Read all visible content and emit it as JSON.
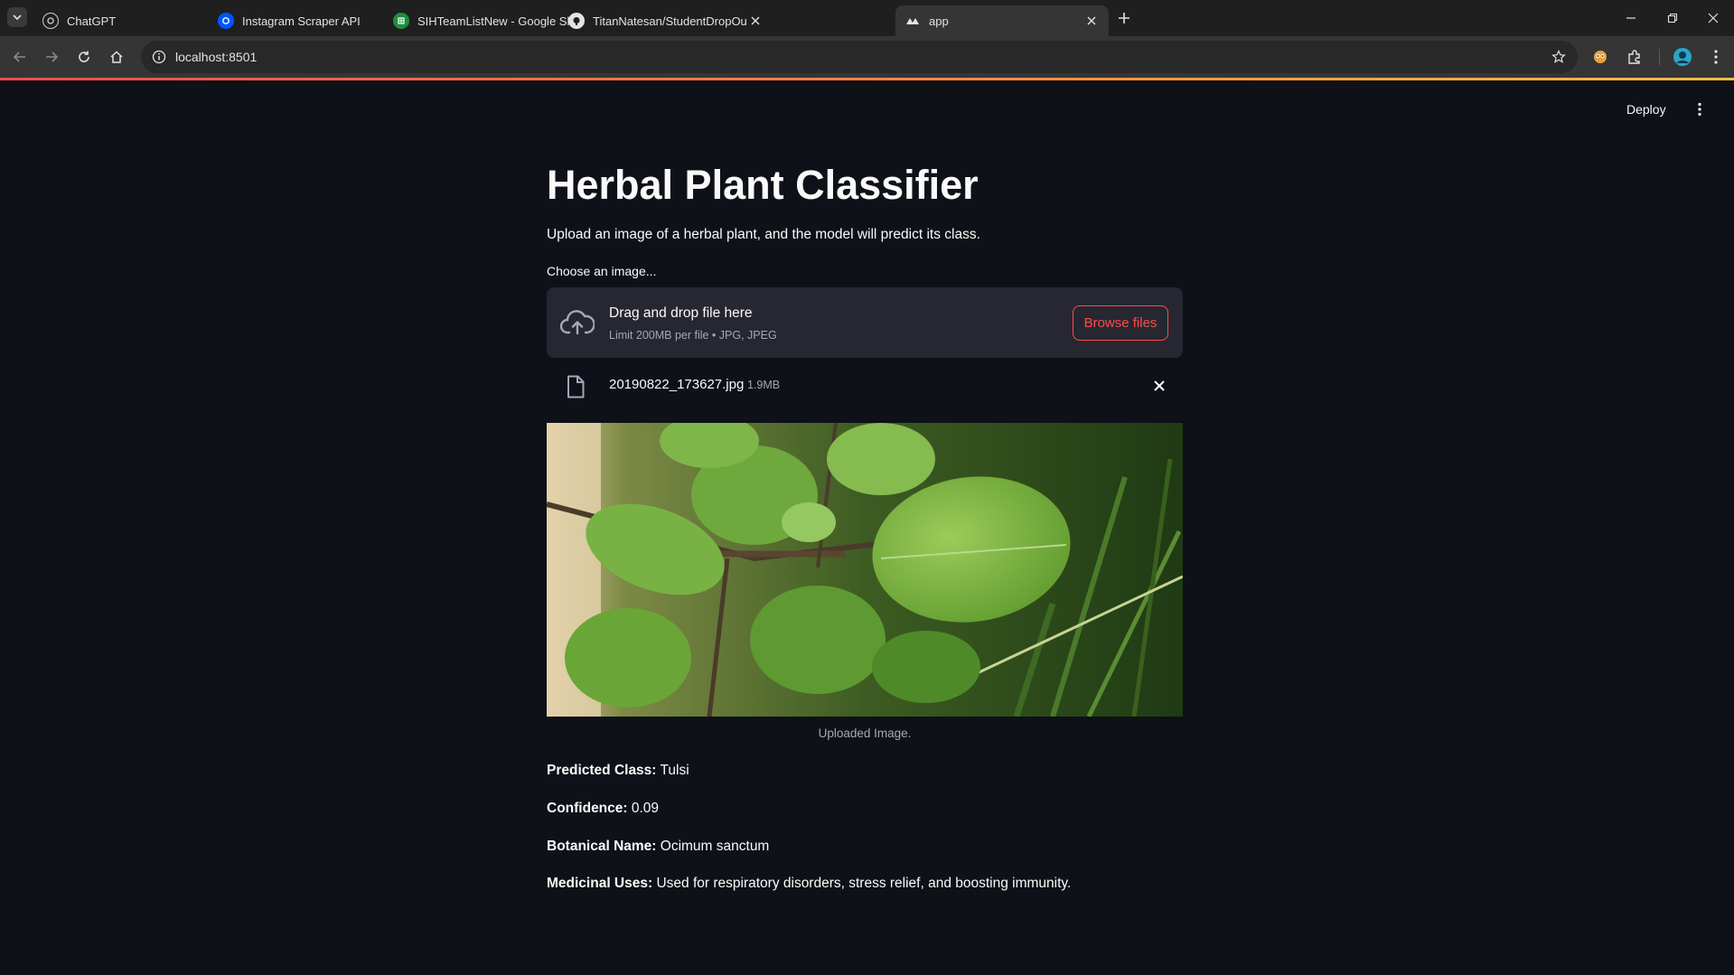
{
  "browser": {
    "tabs": [
      {
        "title": "ChatGPT",
        "icon": "chatgpt-icon",
        "active": false
      },
      {
        "title": "Instagram Scraper API",
        "icon": "rapidapi-icon",
        "active": false
      },
      {
        "title": "SIHTeamListNew - Google Shee",
        "icon": "google-sheets-icon",
        "active": false
      },
      {
        "title": "TitanNatesan/StudentDropOut/",
        "icon": "github-icon",
        "active": false
      },
      {
        "title": "app",
        "icon": "streamlit-icon",
        "active": true
      }
    ],
    "url": "localhost:8501"
  },
  "header": {
    "deploy_label": "Deploy"
  },
  "main": {
    "title": "Herbal Plant Classifier",
    "subtitle": "Upload an image of a herbal plant, and the model will predict its class.",
    "uploader": {
      "label": "Choose an image...",
      "drop_title": "Drag and drop file here",
      "limit_text": "Limit 200MB per file • JPG, JPEG",
      "browse_label": "Browse files"
    },
    "file": {
      "name": "20190822_173627.jpg",
      "size": "1.9MB"
    },
    "image_caption": "Uploaded Image.",
    "results": [
      {
        "label": "Predicted Class:",
        "value": "Tulsi"
      },
      {
        "label": "Confidence:",
        "value": "0.09"
      },
      {
        "label": "Botanical Name:",
        "value": "Ocimum sanctum"
      },
      {
        "label": "Medicinal Uses:",
        "value": "Used for respiratory disorders, stress relief, and boosting immunity."
      }
    ]
  },
  "colors": {
    "background": "#0e1117",
    "accent": "#ff4b4b",
    "dropzone": "#262730",
    "muted_text": "#a3a8b8"
  }
}
